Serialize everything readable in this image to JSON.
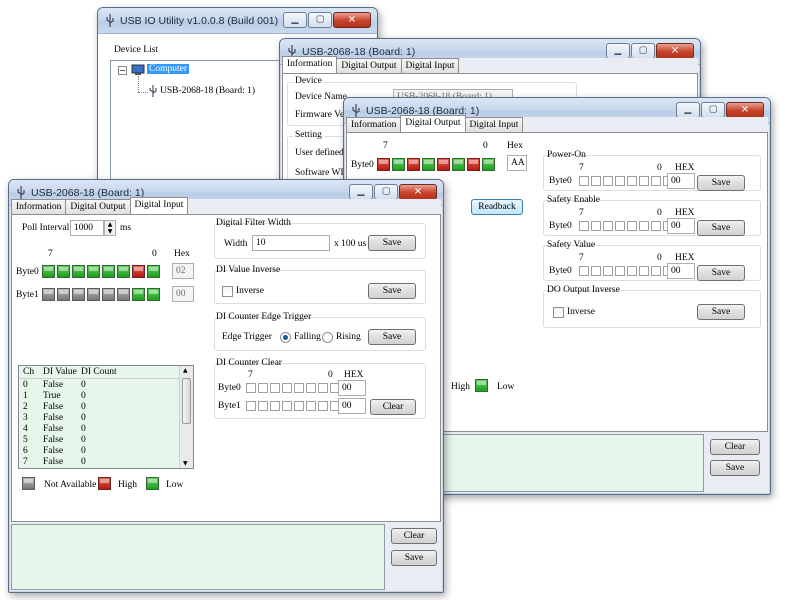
{
  "win1": {
    "title": "USB IO Utility    v1.0.0.8 (Build 001)",
    "device_list_label": "Device List",
    "tree_root": "Computer",
    "tree_child": "USB-2068-18 (Board: 1)"
  },
  "win2": {
    "title": "USB-2068-18 (Board: 1)",
    "tabs": [
      "Information",
      "Digital Output",
      "Digital Input"
    ],
    "device_group": "Device",
    "device_name_label": "Device Name",
    "device_name_value": "USB-2068-18 (Board: 1)",
    "firmware_label": "Firmware Versio",
    "setting_group": "Setting",
    "user_defined_label": "User defined Bo",
    "software_wdt_label": "Software WDT"
  },
  "win3": {
    "title": "USB-2068-18 (Board: 1)",
    "tabs": [
      "Information",
      "Digital Output",
      "Digital Input"
    ],
    "bit_high": "7",
    "bit_low": "0",
    "hex_label": "Hex",
    "byte0_label": "Byte0",
    "byte0_hex": "AA",
    "byte0_states": [
      "high",
      "low",
      "high",
      "low",
      "high",
      "low",
      "high",
      "low"
    ],
    "readback_button": "Readback",
    "power_on": {
      "title": "Power-On",
      "bit_high": "7",
      "bit_low": "0",
      "hex_label": "HEX",
      "byte_label": "Byte0",
      "value": "00",
      "save": "Save"
    },
    "safety_enable": {
      "title": "Safety Enable",
      "bit_high": "7",
      "bit_low": "0",
      "hex_label": "HEX",
      "byte_label": "Byte0",
      "value": "00",
      "save": "Save"
    },
    "safety_value": {
      "title": "Safety Value",
      "bit_high": "7",
      "bit_low": "0",
      "hex_label": "HEX",
      "byte_label": "Byte0",
      "value": "00",
      "save": "Save"
    },
    "do_inverse": {
      "title": "DO Output Inverse",
      "checkbox_label": "Inverse",
      "save": "Save"
    },
    "legend_high": "High",
    "legend_low": "Low",
    "clear_button": "Clear",
    "save_button": "Save"
  },
  "win4": {
    "title": "USB-2068-18 (Board: 1)",
    "tabs": [
      "Information",
      "Digital Output",
      "Digital Input"
    ],
    "poll_interval_label": "Poll Interval",
    "poll_interval_value": "1000",
    "poll_unit": "ms",
    "bit_high": "7",
    "bit_low": "0",
    "hex_label": "Hex",
    "byte0_label": "Byte0",
    "byte0_hex": "02",
    "byte0_states": [
      "low",
      "low",
      "low",
      "low",
      "low",
      "low",
      "high",
      "low"
    ],
    "byte1_label": "Byte1",
    "byte1_hex": "00",
    "byte1_states": [
      "na",
      "na",
      "na",
      "na",
      "na",
      "na",
      "low",
      "low"
    ],
    "list_headers": [
      "Ch",
      "DI Value",
      "DI Count"
    ],
    "list_rows": [
      [
        "0",
        "False",
        "0"
      ],
      [
        "1",
        "True",
        "0"
      ],
      [
        "2",
        "False",
        "0"
      ],
      [
        "3",
        "False",
        "0"
      ],
      [
        "4",
        "False",
        "0"
      ],
      [
        "5",
        "False",
        "0"
      ],
      [
        "6",
        "False",
        "0"
      ],
      [
        "7",
        "False",
        "0"
      ]
    ],
    "legend_na": "Not Available",
    "legend_high": "High",
    "legend_low": "Low",
    "filter": {
      "title": "Digital Filter Width",
      "width_label": "Width",
      "value": "10",
      "unit": "x 100 us",
      "save": "Save"
    },
    "di_inverse": {
      "title": "DI Value Inverse",
      "checkbox_label": "Inverse",
      "save": "Save"
    },
    "edge": {
      "title": "DI Counter Edge Trigger",
      "label": "Edge Trigger",
      "falling": "Falling",
      "rising": "Rising",
      "save": "Save"
    },
    "counter_clear": {
      "title": "DI Counter Clear",
      "bit_high": "7",
      "bit_low": "0",
      "hex_label": "HEX",
      "byte0_label": "Byte0",
      "byte0_value": "00",
      "byte1_label": "Byte1",
      "byte1_value": "00",
      "clear": "Clear"
    },
    "clear_button": "Clear",
    "save_button": "Save"
  }
}
